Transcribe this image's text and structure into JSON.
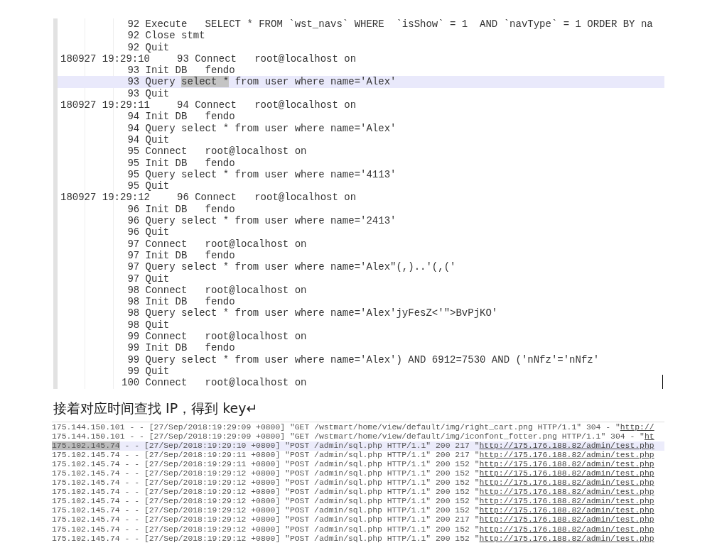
{
  "query_log": {
    "lines": [
      {
        "id": "92",
        "text": "Execute   SELECT * FROM `wst_navs` WHERE  `isShow` = 1  AND `navType` = 1 ORDER BY na",
        "selected": false
      },
      {
        "id": "92",
        "text": "Close stmt",
        "selected": false
      },
      {
        "id": "92",
        "text": "Quit",
        "selected": false
      },
      {
        "time": "180927 19:29:10",
        "id": "93",
        "text": "Connect   root@localhost on",
        "selected": false
      },
      {
        "id": "93",
        "text": "Init DB   fendo",
        "selected": false
      },
      {
        "id": "93",
        "prefix": "Query ",
        "selection": "select *",
        "text": " from user where name='Alex'",
        "selected": true
      },
      {
        "id": "93",
        "text": "Quit",
        "selected": false
      },
      {
        "time": "180927 19:29:11",
        "id": "94",
        "text": "Connect   root@localhost on",
        "selected": false
      },
      {
        "id": "94",
        "text": "Init DB   fendo",
        "selected": false
      },
      {
        "id": "94",
        "text": "Query select * from user where name='Alex'",
        "selected": false
      },
      {
        "id": "94",
        "text": "Quit",
        "selected": false
      },
      {
        "id": "95",
        "text": "Connect   root@localhost on",
        "selected": false
      },
      {
        "id": "95",
        "text": "Init DB   fendo",
        "selected": false
      },
      {
        "id": "95",
        "text": "Query select * from user where name='4113'",
        "selected": false
      },
      {
        "id": "95",
        "text": "Quit",
        "selected": false
      },
      {
        "time": "180927 19:29:12",
        "id": "96",
        "text": "Connect   root@localhost on",
        "selected": false
      },
      {
        "id": "96",
        "text": "Init DB   fendo",
        "selected": false
      },
      {
        "id": "96",
        "text": "Query select * from user where name='2413'",
        "selected": false
      },
      {
        "id": "96",
        "text": "Quit",
        "selected": false
      },
      {
        "id": "97",
        "text": "Connect   root@localhost on",
        "selected": false
      },
      {
        "id": "97",
        "text": "Init DB   fendo",
        "selected": false
      },
      {
        "id": "97",
        "text": "Query select * from user where name='Alex\"(,)..'(,('",
        "selected": false
      },
      {
        "id": "97",
        "text": "Quit",
        "selected": false
      },
      {
        "id": "98",
        "text": "Connect   root@localhost on",
        "selected": false
      },
      {
        "id": "98",
        "text": "Init DB   fendo",
        "selected": false
      },
      {
        "id": "98",
        "text": "Query select * from user where name='Alex'jyFesZ<'\">BvPjKO'",
        "selected": false
      },
      {
        "id": "98",
        "text": "Quit",
        "selected": false
      },
      {
        "id": "99",
        "text": "Connect   root@localhost on",
        "selected": false
      },
      {
        "id": "99",
        "text": "Init DB   fendo",
        "selected": false
      },
      {
        "id": "99",
        "text": "Query select * from user where name='Alex') AND 6912=7530 AND ('nNfz'='nNfz'",
        "selected": false
      },
      {
        "id": "99",
        "text": "Quit",
        "selected": false
      },
      {
        "id": "100",
        "text": "Connect   root@localhost on",
        "selected": false
      }
    ]
  },
  "paragraph": "接着对应时间查找 IP，得到 key↵",
  "access_log": {
    "rows": [
      {
        "ip": "175.144.150.101",
        "rest": " - - [27/Sep/2018:19:29:09 +0800] \"GET /wstmart/home/view/default/img/right_cart.png HTTP/1.1\" 304 - \"",
        "referer": "http://",
        "selected": false
      },
      {
        "ip": "175.144.150.101",
        "rest": " - - [27/Sep/2018:19:29:09 +0800] \"GET /wstmart/home/view/default/img/iconfont_fotter.png HTTP/1.1\" 304 - \"",
        "referer": "ht",
        "selected": false
      },
      {
        "ip": "175.102.145.74",
        "rest": " - - [27/Sep/2018:19:29:10 +0800] \"POST /admin/sql.php HTTP/1.1\" 200 217 \"",
        "referer": "http://175.176.188.82/admin/test.php",
        "selected": true
      },
      {
        "ip": "175.102.145.74",
        "rest": " - - [27/Sep/2018:19:29:11 +0800] \"POST /admin/sql.php HTTP/1.1\" 200 217 \"",
        "referer": "http://175.176.188.82/admin/test.php",
        "selected": false
      },
      {
        "ip": "175.102.145.74",
        "rest": " - - [27/Sep/2018:19:29:11 +0800] \"POST /admin/sql.php HTTP/1.1\" 200 152 \"",
        "referer": "http://175.176.188.82/admin/test.php",
        "selected": false
      },
      {
        "ip": "175.102.145.74",
        "rest": " - - [27/Sep/2018:19:29:12 +0800] \"POST /admin/sql.php HTTP/1.1\" 200 152 \"",
        "referer": "http://175.176.188.82/admin/test.php",
        "selected": false
      },
      {
        "ip": "175.102.145.74",
        "rest": " - - [27/Sep/2018:19:29:12 +0800] \"POST /admin/sql.php HTTP/1.1\" 200 152 \"",
        "referer": "http://175.176.188.82/admin/test.php",
        "selected": false
      },
      {
        "ip": "175.102.145.74",
        "rest": " - - [27/Sep/2018:19:29:12 +0800] \"POST /admin/sql.php HTTP/1.1\" 200 152 \"",
        "referer": "http://175.176.188.82/admin/test.php",
        "selected": false
      },
      {
        "ip": "175.102.145.74",
        "rest": " - - [27/Sep/2018:19:29:12 +0800] \"POST /admin/sql.php HTTP/1.1\" 200 152 \"",
        "referer": "http://175.176.188.82/admin/test.php",
        "selected": false
      },
      {
        "ip": "175.102.145.74",
        "rest": " - - [27/Sep/2018:19:29:12 +0800] \"POST /admin/sql.php HTTP/1.1\" 200 152 \"",
        "referer": "http://175.176.188.82/admin/test.php",
        "selected": false
      },
      {
        "ip": "175.102.145.74",
        "rest": " - - [27/Sep/2018:19:29:12 +0800] \"POST /admin/sql.php HTTP/1.1\" 200 217 \"",
        "referer": "http://175.176.188.82/admin/test.php",
        "selected": false
      },
      {
        "ip": "175.102.145.74",
        "rest": " - - [27/Sep/2018:19:29:12 +0800] \"POST /admin/sql.php HTTP/1.1\" 200 152 \"",
        "referer": "http://175.176.188.82/admin/test.php",
        "selected": false
      },
      {
        "ip": "175.102.145.74",
        "rest": " - - [27/Sep/2018:19:29:12 +0800] \"POST /admin/sql.php HTTP/1.1\" 200 152 \"",
        "referer": "http://175.176.188.82/admin/test.php",
        "selected": false
      }
    ]
  }
}
